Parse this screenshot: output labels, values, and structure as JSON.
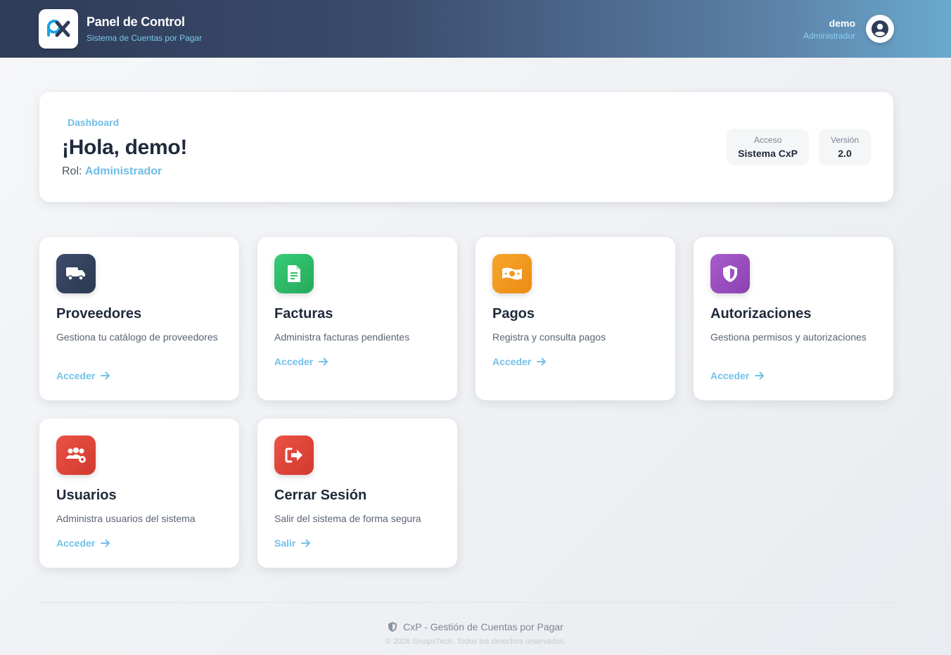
{
  "header": {
    "title": "Panel de Control",
    "subtitle": "Sistema de Cuentas por Pagar",
    "user_name": "demo",
    "user_role": "Administrador"
  },
  "welcome": {
    "breadcrumb": "Dashboard",
    "greeting": "¡Hola, demo!",
    "role_label": "Rol:",
    "role_value": "Administrador",
    "chips": [
      {
        "label": "Acceso",
        "value": "Sistema CxP"
      },
      {
        "label": "Versión",
        "value": "2.0"
      }
    ]
  },
  "cards": [
    {
      "title": "Proveedores",
      "desc": "Gestiona tu catálogo de proveedores",
      "link": "Acceder",
      "icon": "truck-icon",
      "color": "#34425e"
    },
    {
      "title": "Facturas",
      "desc": "Administra facturas pendientes",
      "link": "Acceder",
      "icon": "invoice-icon",
      "color": "#2fc06a"
    },
    {
      "title": "Pagos",
      "desc": "Registra y consulta pagos",
      "link": "Acceder",
      "icon": "money-icon",
      "color": "#f39a1f"
    },
    {
      "title": "Autorizaciones",
      "desc": "Gestiona permisos y autorizaciones",
      "link": "Acceder",
      "icon": "shield-icon",
      "color": "#9b4fc0"
    },
    {
      "title": "Usuarios",
      "desc": "Administra usuarios del sistema",
      "link": "Acceder",
      "icon": "users-gear-icon",
      "color": "#e0453a"
    },
    {
      "title": "Cerrar Sesión",
      "desc": "Salir del sistema de forma segura",
      "link": "Salir",
      "icon": "logout-icon",
      "color": "#e0453a"
    }
  ],
  "footer": {
    "main": "CxP - Gestión de Cuentas por Pagar",
    "sub": "© 2026 SinapsTech. Todos los derechos reservados."
  }
}
